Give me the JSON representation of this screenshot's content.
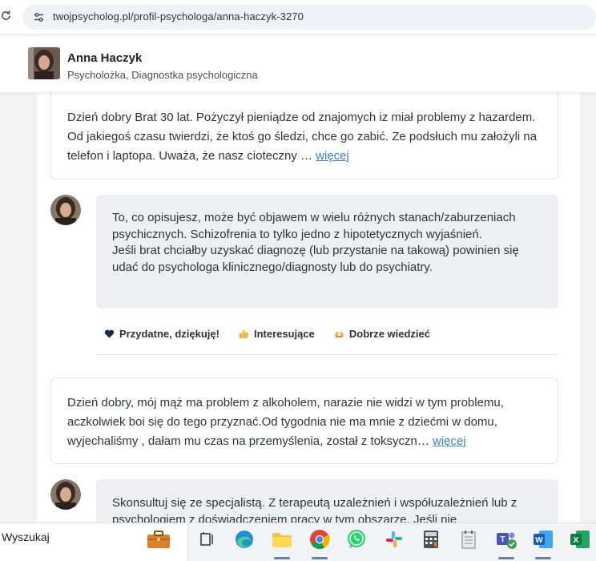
{
  "browser": {
    "url": "twojpsycholog.pl/profil-psychologa/anna-haczyk-3270"
  },
  "profile": {
    "name": "Anna Haczyk",
    "title": "Psycholożka, Diagnostka psychologiczna"
  },
  "questions": [
    {
      "text": "Dzień dobry Brat 30 lat. Pożyczył pieniądze od znajomych iz miał problemy z hazardem. Od jakiegoś czasu twierdzi, że ktoś go śledzi, chce go zabić. Ze podsłuch mu założyli na telefon i laptopa. Uważa, że nasz cioteczny …",
      "more": "więcej"
    },
    {
      "text": "Dzień dobry, mój mąż ma problem z alkoholem, narazie nie widzi w tym problemu, aczkolwiek boi się do tego przyznać.Od tygodnia nie ma mnie z dziećmi w domu, wyjechaliśmy , dałam mu czas na przemyślenia, został z toksyczn…",
      "more": "więcej"
    }
  ],
  "answers": [
    {
      "line1": "To, co opisujesz, może być objawem w wielu różnych stanach/zaburzeniach psychicznych. Schizofrenia to tylko jedno z hipotetycznych wyjaśnień.",
      "line2": "Jeśli brat chciałby uzyskać diagnozę (lub przystanie na takową) powinien się udać do psychologa klinicznego/diagnosty lub do psychiatry."
    },
    {
      "line1": "Skonsultuj się ze specjalistą. Z terapeutą uzależnień i współuzależnień lub z psychologiem z doświadczeniem pracy w tym obszarze. Jeśli nie"
    }
  ],
  "reactions": [
    {
      "label": "Przydatne, dziękuję!",
      "icon": "heart-icon"
    },
    {
      "label": "Interesujące",
      "icon": "thumbs-up-icon"
    },
    {
      "label": "Dobrze wiedzieć",
      "icon": "hands-icon"
    }
  ],
  "taskbar": {
    "search_label": "Wyszukaj",
    "apps": [
      "briefcase-icon",
      "task-view-icon",
      "edge-icon",
      "file-explorer-icon",
      "chrome-icon",
      "whatsapp-icon",
      "slack-icon",
      "calculator-icon",
      "notepad-icon",
      "teams-icon",
      "word-icon",
      "excel-icon"
    ]
  },
  "colors": {
    "link": "#3a7fc0",
    "answer_bg": "#eeeff2",
    "page_bg": "#f3f3f4"
  }
}
